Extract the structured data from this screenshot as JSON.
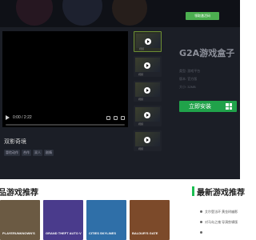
{
  "header": {
    "top_button_label": "领取激活码"
  },
  "video": {
    "time": "0:00 / 2:22",
    "title": "双影奇境",
    "tags": [
      "冒险动作",
      "合作",
      "双人",
      "剧情"
    ]
  },
  "thumbnails": [
    {
      "label": "视频"
    },
    {
      "label": "视频"
    },
    {
      "label": "视频"
    },
    {
      "label": "视频"
    },
    {
      "label": "视频"
    }
  ],
  "app": {
    "title": "G2A游戏盒子",
    "meta_lines": [
      "类型: 游戏平台",
      "版本: 官方版",
      "大小: 32MB"
    ],
    "install_label": "立即安装",
    "install_icon": "windows-icon"
  },
  "sections": {
    "left_title": "品游戏推荐",
    "right_title": "最新游戏推荐"
  },
  "games": [
    {
      "caption": "PLAYERUNKNOWN'S",
      "color": "#6b5a43"
    },
    {
      "caption": "GRAND THEFT AUTO V",
      "color": "#4a3b8c"
    },
    {
      "caption": "CITIES SKYLINES",
      "color": "#2f6fa8"
    },
    {
      "caption": "BALDUR'S GATE",
      "color": "#7c4a2a"
    }
  ],
  "news": [
    {
      "text": "艾尔登法环 黄金树幽影"
    },
    {
      "text": "对马岛之魂 导演剪辑版"
    },
    {
      "text": ""
    },
    {
      "text": ""
    }
  ],
  "colors": {
    "accent_green": "#20a24a",
    "dark_bg": "#1b1e26",
    "section_bar": "#1bbf52"
  }
}
